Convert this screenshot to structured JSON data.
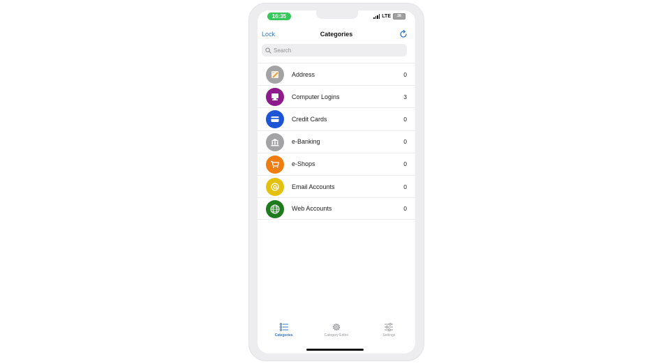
{
  "status_bar": {
    "time": "16:35",
    "network": "LTE",
    "battery": "28"
  },
  "nav": {
    "left": "Lock",
    "title": "Categories",
    "right_icon": "refresh-icon"
  },
  "search": {
    "placeholder": "Search"
  },
  "categories": [
    {
      "label": "Address",
      "count": "0",
      "icon": "address-icon",
      "color": "#a3a3a6"
    },
    {
      "label": "Computer Logins",
      "count": "3",
      "icon": "computer-icon",
      "color": "#8e1b8c"
    },
    {
      "label": "Credit Cards",
      "count": "0",
      "icon": "credit-card-icon",
      "color": "#1c54d4"
    },
    {
      "label": "e-Banking",
      "count": "0",
      "icon": "bank-icon",
      "color": "#a3a3a6"
    },
    {
      "label": "e-Shops",
      "count": "0",
      "icon": "shopping-cart-icon",
      "color": "#f07d12"
    },
    {
      "label": "Email Accounts",
      "count": "0",
      "icon": "email-icon",
      "color": "#e4c10f"
    },
    {
      "label": "Web Accounts",
      "count": "0",
      "icon": "globe-icon",
      "color": "#1d7a1d"
    }
  ],
  "tabs": [
    {
      "label": "Categories",
      "icon": "list-icon",
      "active": true
    },
    {
      "label": "Category Editor",
      "icon": "gear-icon",
      "active": false
    },
    {
      "label": "Settings",
      "icon": "sliders-icon",
      "active": false
    }
  ],
  "colors": {
    "accent": "#3478c6",
    "status_green": "#34c759"
  }
}
